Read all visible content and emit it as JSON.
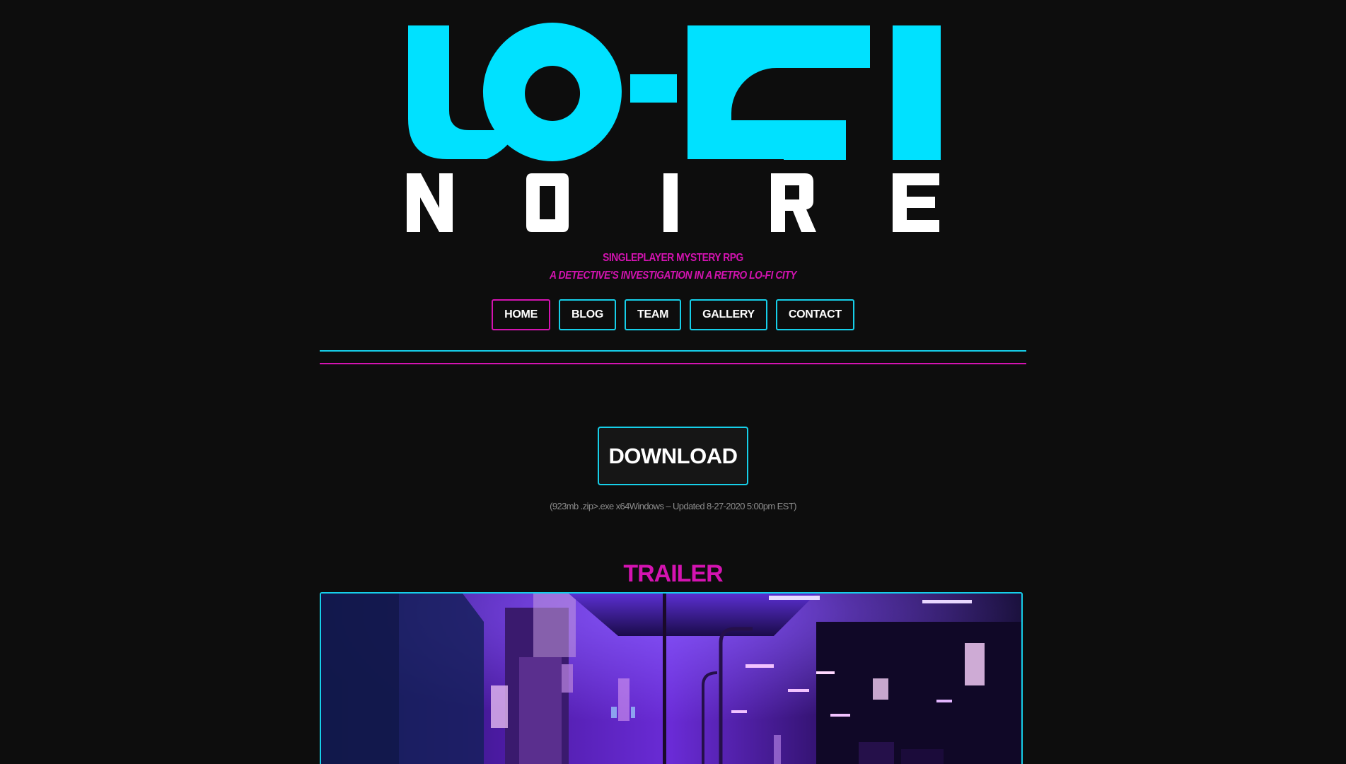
{
  "logo": {
    "top_text": "LO-FI",
    "bottom_text": "NOIRE",
    "top_color": "#00e1ff",
    "bottom_color": "#ffffff"
  },
  "tagline": {
    "line1": "SINGLEPLAYER MYSTERY RPG",
    "line2": "A DETECTIVE'S INVESTIGATION IN A RETRO LO-FI CITY"
  },
  "nav": {
    "items": [
      {
        "label": "HOME",
        "active": true
      },
      {
        "label": "BLOG",
        "active": false
      },
      {
        "label": "TEAM",
        "active": false
      },
      {
        "label": "GALLERY",
        "active": false
      },
      {
        "label": "CONTACT",
        "active": false
      }
    ]
  },
  "download": {
    "label": "DOWNLOAD",
    "info": "(923mb .zip>.exe x64Windows – Updated 8-27-2020 5:00pm EST)"
  },
  "trailer": {
    "heading": "TRAILER",
    "preview": "trailer-preview-image"
  },
  "colors": {
    "background": "#0d0d0d",
    "accent_cyan": "#16cfe9",
    "accent_magenta": "#d413b1",
    "text": "#ffffff"
  }
}
